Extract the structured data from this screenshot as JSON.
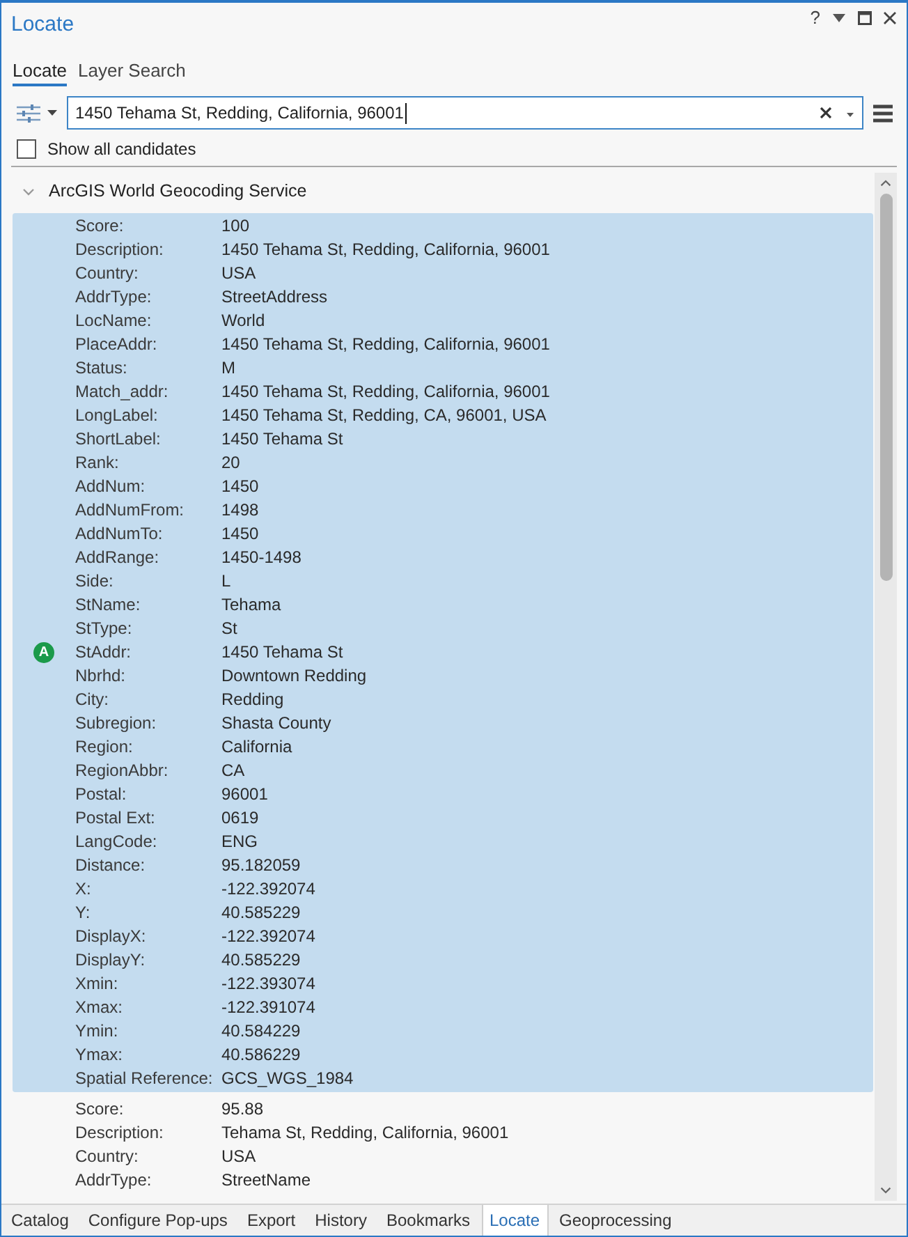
{
  "window": {
    "title": "Locate",
    "help": "?"
  },
  "tabs": [
    {
      "label": "Locate",
      "selected": true
    },
    {
      "label": "Layer Search",
      "selected": false
    }
  ],
  "search": {
    "value": "1450 Tehama St, Redding, California, 96001"
  },
  "show_all_candidates": {
    "label": "Show all candidates",
    "checked": false
  },
  "results": [
    {
      "title": "ArcGIS World Geocoding Service",
      "expanded": true,
      "candidates": [
        {
          "selected": true,
          "marker": "A",
          "fields": [
            {
              "label": "Score:",
              "value": "100"
            },
            {
              "label": "Description:",
              "value": "1450 Tehama St, Redding, California, 96001"
            },
            {
              "label": "Country:",
              "value": "USA"
            },
            {
              "label": "AddrType:",
              "value": "StreetAddress"
            },
            {
              "label": "LocName:",
              "value": "World"
            },
            {
              "label": "PlaceAddr:",
              "value": "1450 Tehama St, Redding, California, 96001"
            },
            {
              "label": "Status:",
              "value": "M"
            },
            {
              "label": "Match_addr:",
              "value": "1450 Tehama St, Redding, California, 96001"
            },
            {
              "label": "LongLabel:",
              "value": "1450 Tehama St, Redding, CA, 96001, USA"
            },
            {
              "label": "ShortLabel:",
              "value": "1450 Tehama St"
            },
            {
              "label": "Rank:",
              "value": "20"
            },
            {
              "label": "AddNum:",
              "value": "1450"
            },
            {
              "label": "AddNumFrom:",
              "value": "1498"
            },
            {
              "label": "AddNumTo:",
              "value": "1450"
            },
            {
              "label": "AddRange:",
              "value": "1450-1498"
            },
            {
              "label": "Side:",
              "value": "L"
            },
            {
              "label": "StName:",
              "value": "Tehama"
            },
            {
              "label": "StType:",
              "value": "St"
            },
            {
              "label": "StAddr:",
              "value": "1450 Tehama St"
            },
            {
              "label": "Nbrhd:",
              "value": "Downtown Redding"
            },
            {
              "label": "City:",
              "value": "Redding"
            },
            {
              "label": "Subregion:",
              "value": "Shasta County"
            },
            {
              "label": "Region:",
              "value": "California"
            },
            {
              "label": "RegionAbbr:",
              "value": "CA"
            },
            {
              "label": "Postal:",
              "value": "96001"
            },
            {
              "label": "Postal Ext:",
              "value": "0619"
            },
            {
              "label": "LangCode:",
              "value": "ENG"
            },
            {
              "label": "Distance:",
              "value": "95.182059"
            },
            {
              "label": "X:",
              "value": "-122.392074"
            },
            {
              "label": "Y:",
              "value": "40.585229"
            },
            {
              "label": "DisplayX:",
              "value": "-122.392074"
            },
            {
              "label": "DisplayY:",
              "value": "40.585229"
            },
            {
              "label": "Xmin:",
              "value": "-122.393074"
            },
            {
              "label": "Xmax:",
              "value": "-122.391074"
            },
            {
              "label": "Ymin:",
              "value": "40.584229"
            },
            {
              "label": "Ymax:",
              "value": "40.586229"
            },
            {
              "label": "Spatial Reference:",
              "value": "GCS_WGS_1984"
            }
          ]
        },
        {
          "selected": false,
          "fields": [
            {
              "label": "Score:",
              "value": "95.88"
            },
            {
              "label": "Description:",
              "value": "Tehama St, Redding, California, 96001"
            },
            {
              "label": "Country:",
              "value": "USA"
            },
            {
              "label": "AddrType:",
              "value": "StreetName"
            }
          ]
        }
      ]
    }
  ],
  "bottom_tabs": [
    {
      "label": "Catalog",
      "selected": false
    },
    {
      "label": "Configure Pop-ups",
      "selected": false
    },
    {
      "label": "Export",
      "selected": false
    },
    {
      "label": "History",
      "selected": false
    },
    {
      "label": "Bookmarks",
      "selected": false
    },
    {
      "label": "Locate",
      "selected": true
    },
    {
      "label": "Geoprocessing",
      "selected": false
    }
  ]
}
